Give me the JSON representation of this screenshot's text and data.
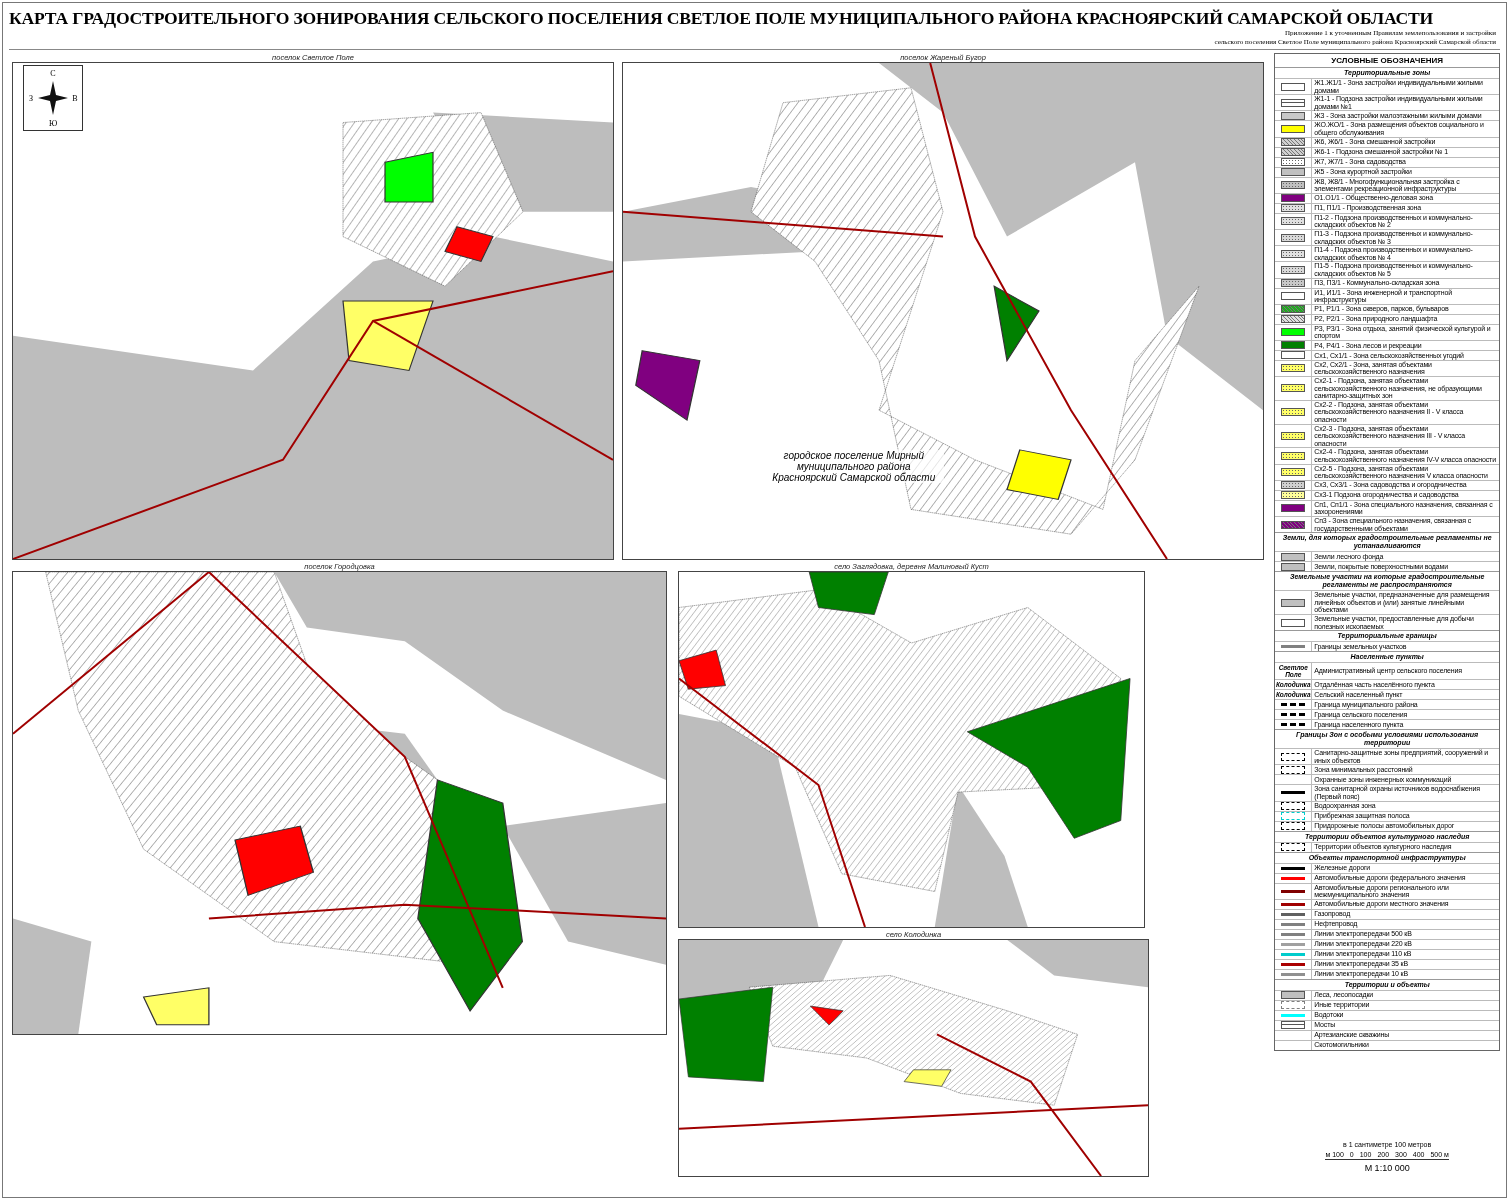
{
  "header": {
    "title": "КАРТА ГРАДОСТРОИТЕЛЬНОГО ЗОНИРОВАНИЯ СЕЛЬСКОГО ПОСЕЛЕНИЯ СВЕТЛОЕ ПОЛЕ МУНИЦИПАЛЬНОГО РАЙОНА КРАСНОЯРСКИЙ САМАРСКОЙ ОБЛАСТИ",
    "subtitle": [
      "Приложение 1 к уточненным Правилам землепользования и застройки",
      "сельского поселения Светлое Поле муниципального района Красноярский Самарской области"
    ]
  },
  "panels": [
    {
      "title": "поселок Светлое Поле",
      "compass": {
        "north": "С",
        "south": "Ю",
        "west": "З",
        "east": "В"
      }
    },
    {
      "title": "поселок Жареный Бугор",
      "note": "городское поселение Мирный муниципального района Красноярский Самарской области"
    },
    {
      "title": "поселок Городцовка"
    },
    {
      "title": "село Заглядовка, деревня Малиновый Куст"
    },
    {
      "title": "село Колодинка"
    }
  ],
  "legend": {
    "title": "УСЛОВНЫЕ ОБОЗНАЧЕНИЯ",
    "sections": [
      {
        "title": "Территориальные зоны",
        "items": [
          {
            "kind": "fill",
            "color": "#ffffff",
            "label": "Ж1.Ж1/1 - Зона застройки индивидуальными жилыми домами"
          },
          {
            "kind": "double",
            "color": "#ffffff",
            "label": "Ж1-1 - Подзона застройки индивидуальными жилыми домами №1"
          },
          {
            "kind": "fill",
            "color": "#c8c8c8",
            "label": "Ж3 - Зона застройки малоэтажными жилыми домами"
          },
          {
            "kind": "fill",
            "color": "#ffff00",
            "label": "ЖО.ЖО/1 - Зона размещения объектов социального и общего обслуживания"
          },
          {
            "kind": "hatch",
            "color": "#d0d0d0",
            "label": "Ж6, Ж6/1 - Зона смешанной застройки"
          },
          {
            "kind": "hatch",
            "color": "#d0d0d0",
            "label": "Ж6-1 - Подзона смешанной застройки № 1"
          },
          {
            "kind": "dots",
            "color": "#ffffff",
            "label": "Ж7, Ж7/1 - Зона садоводства"
          },
          {
            "kind": "fill",
            "color": "#c0c0c0",
            "label": "Ж5 - Зона курортной застройки"
          },
          {
            "kind": "dots",
            "color": "#c0c0c0",
            "label": "Ж8, Ж8/1 - Многофункциональная застройка с элементами рекреационной инфраструктуры"
          },
          {
            "kind": "fill",
            "color": "#800080",
            "label": "О1.О1/1 - Общественно-деловая зона"
          },
          {
            "kind": "dots",
            "color": "#e0e0e0",
            "label": "П1, П1/1 - Производственная зона"
          },
          {
            "kind": "dots",
            "color": "#e0e0e0",
            "label": "П1-2 - Подзона производственных и коммунально-складских объектов № 2"
          },
          {
            "kind": "dots",
            "color": "#d8d8d8",
            "label": "П1-3 - Подзона производственных и коммунально-складских объектов № 3"
          },
          {
            "kind": "dots",
            "color": "#e0e0e0",
            "label": "П1-4 - Подзона производственных и коммунально-складских объектов № 4"
          },
          {
            "kind": "dots",
            "color": "#d8d8d8",
            "label": "П1-5 - Подзона производственных и коммунально-складских объектов № 5"
          },
          {
            "kind": "dots",
            "color": "#c8c8c8",
            "label": "П3, П3/1 - Коммунально-складская зона"
          },
          {
            "kind": "fill",
            "color": "#ffffff",
            "label": "И1, И1/1 - Зона инженерной и транспортной инфраструктуры"
          },
          {
            "kind": "hatch",
            "color": "#22aa22",
            "label": "Р1, Р1/1 - Зона скверов, парков, бульваров"
          },
          {
            "kind": "hatch",
            "color": "#e0e0e0",
            "label": "Р2, Р2/1 - Зона природного ландшафта"
          },
          {
            "kind": "fill",
            "color": "#00ff00",
            "label": "Р3, Р3/1 - Зона отдыха, занятий физической культурой и спортом"
          },
          {
            "kind": "fill",
            "color": "#008000",
            "label": "Р4, Р4/1 - Зона лесов и рекреации"
          },
          {
            "kind": "fill",
            "color": "#ffffff",
            "label": "Сх1, Сх1/1 - Зона сельскохозяйственных угодий"
          },
          {
            "kind": "dots",
            "color": "#ffff66",
            "label": "Сх2, Сх2/1 - Зона, занятая объектами сельскохозяйственного назначения"
          },
          {
            "kind": "dots",
            "color": "#ffff66",
            "label": "Сх2-1 - Подзона, занятая объектами сельскохозяйственного назначения, не образующими санитарно-защитных зон"
          },
          {
            "kind": "dots",
            "color": "#ffff66",
            "label": "Сх2-2 - Подзона, занятая объектами сельскохозяйственного назначения II - V класса опасности"
          },
          {
            "kind": "dots",
            "color": "#ffff66",
            "label": "Сх2-3 - Подзона, занятая объектами сельскохозяйственного назначения III - V класса опасности"
          },
          {
            "kind": "dots",
            "color": "#ffff66",
            "label": "Сх2-4 - Подзона, занятая объектами сельскохозяйственного назначения IV-V класса опасности"
          },
          {
            "kind": "dots",
            "color": "#ffff66",
            "label": "Сх2-5 - Подзона, занятая объектами сельскохозяйственного назначения V класса опасности"
          },
          {
            "kind": "dots",
            "color": "#d0d0d0",
            "label": "Сх3, Сх3/1 - Зона садоводства и огородничества"
          },
          {
            "kind": "dots",
            "color": "#ffff99",
            "label": "Сх3-1 Подзона огородничества и садоводства"
          },
          {
            "kind": "fill",
            "color": "#800080",
            "label": "Сп1, Сп1/1 - Зона специального назначения, связанная с захоронениями"
          },
          {
            "kind": "hatch",
            "color": "#800080",
            "label": "Сп3 - Зона специального назначения, связанная с государственными объектами"
          }
        ]
      },
      {
        "title": "Земли, для которых градостроительные регламенты не устанавливаются",
        "items": [
          {
            "kind": "fill",
            "color": "#c0c0c0",
            "label": "Земли лесного фонда"
          },
          {
            "kind": "fill",
            "color": "#c0c0c0",
            "label": "Земли, покрытые поверхностными водами"
          }
        ]
      },
      {
        "title": "Земельные участки на которые градостроительные регламенты не распространяются",
        "items": [
          {
            "kind": "fill",
            "color": "#c0c0c0",
            "label": "Земельные участки, предназначенные для размещения линейных объектов и (или) занятые линейными объектами"
          },
          {
            "kind": "fill",
            "color": "#ffffff",
            "label": "Земельные участки, предоставленные для добычи полезных ископаемых"
          }
        ]
      },
      {
        "title": "Территориальные границы",
        "items": [
          {
            "kind": "line",
            "color": "#808080",
            "label": "Границы земельных участков"
          }
        ]
      },
      {
        "title": "Населенные пункты",
        "items": [
          {
            "kind": "sample",
            "sample": "Светлое Поле",
            "label": "Административный центр сельского поселения"
          },
          {
            "kind": "sample",
            "sample": "Колодинка",
            "label": "Отдалённая часть населённого пункта"
          },
          {
            "kind": "sample",
            "sample": "Колодинка",
            "label": "Сельский населенный пункт"
          },
          {
            "kind": "dash",
            "color": "#000000",
            "label": "Граница муниципального района"
          },
          {
            "kind": "dash",
            "color": "#000000",
            "label": "Граница сельского поселения"
          },
          {
            "kind": "dash",
            "color": "#000000",
            "label": "Граница населенного пункта"
          }
        ]
      },
      {
        "title": "Границы Зон с особыми условиями использования территории",
        "items": [
          {
            "kind": "frame",
            "color": "#000000",
            "label": "Санитарно-защитные зоны предприятий, сооружений и иных объектов"
          },
          {
            "kind": "frame",
            "color": "#000000",
            "label": "Зона минимальных расстояний"
          },
          {
            "kind": "blank",
            "label": "Охранные зоны инженерных коммуникаций"
          },
          {
            "kind": "line",
            "color": "#000000",
            "label": "Зона санитарной охраны источников водоснабжения (Первый пояс)"
          },
          {
            "kind": "frame",
            "color": "#000000",
            "label": "Водоохранная зона"
          },
          {
            "kind": "frame",
            "color": "#00cccc",
            "label": "Прибрежная защитная полоса"
          },
          {
            "kind": "frame",
            "color": "#000000",
            "label": "Придорожные полосы автомобильных дорог"
          }
        ]
      },
      {
        "title": "Территории объектов культурного наследия",
        "items": [
          {
            "kind": "frame",
            "color": "#000000",
            "label": "Территории объектов культурного наследия"
          }
        ]
      },
      {
        "title": "Объекты транспортной инфраструктуры",
        "items": [
          {
            "kind": "line",
            "color": "#000000",
            "label": "Железные дороги"
          },
          {
            "kind": "line",
            "color": "#ff0000",
            "label": "Автомобильные дороги федерального значения"
          },
          {
            "kind": "line",
            "color": "#800000",
            "label": "Автомобильные дороги регионального или межмуниципального значения"
          },
          {
            "kind": "line",
            "color": "#a00000",
            "label": "Автомобильные дороги местного значения"
          },
          {
            "kind": "line",
            "color": "#606060",
            "label": "Газопровод"
          },
          {
            "kind": "line",
            "color": "#808080",
            "label": "Нефтепровод"
          },
          {
            "kind": "line",
            "color": "#808080",
            "label": "Линии электропередачи 500 кВ"
          },
          {
            "kind": "line",
            "color": "#a0a0a0",
            "label": "Линии электропередачи 220 кВ"
          },
          {
            "kind": "line",
            "color": "#00cccc",
            "label": "Линии электропередачи 110 кВ"
          },
          {
            "kind": "line",
            "color": "#aa0000",
            "label": "Линии электропередачи 35 кВ"
          },
          {
            "kind": "line",
            "color": "#909090",
            "label": "Линии электропередачи 10 кВ"
          }
        ]
      },
      {
        "title": "Территории и объекты",
        "items": [
          {
            "kind": "fill",
            "color": "#c0c0c0",
            "label": "Леса, лесопосадки"
          },
          {
            "kind": "frame",
            "color": "#808080",
            "label": "Иные территории"
          },
          {
            "kind": "line",
            "color": "#00ffff",
            "label": "Водотоки"
          },
          {
            "kind": "double",
            "color": "#ffffff",
            "label": "Мосты"
          },
          {
            "kind": "blank",
            "label": "Артезианские скважины"
          },
          {
            "kind": "blank",
            "label": "Скотомогильники"
          }
        ]
      }
    ]
  },
  "scale": {
    "caption": "в 1 сантиметре 100 метров",
    "ticks": [
      "м 100",
      "0",
      "100",
      "200",
      "300",
      "400",
      "500 м"
    ],
    "ratio": "М 1:10 000"
  }
}
